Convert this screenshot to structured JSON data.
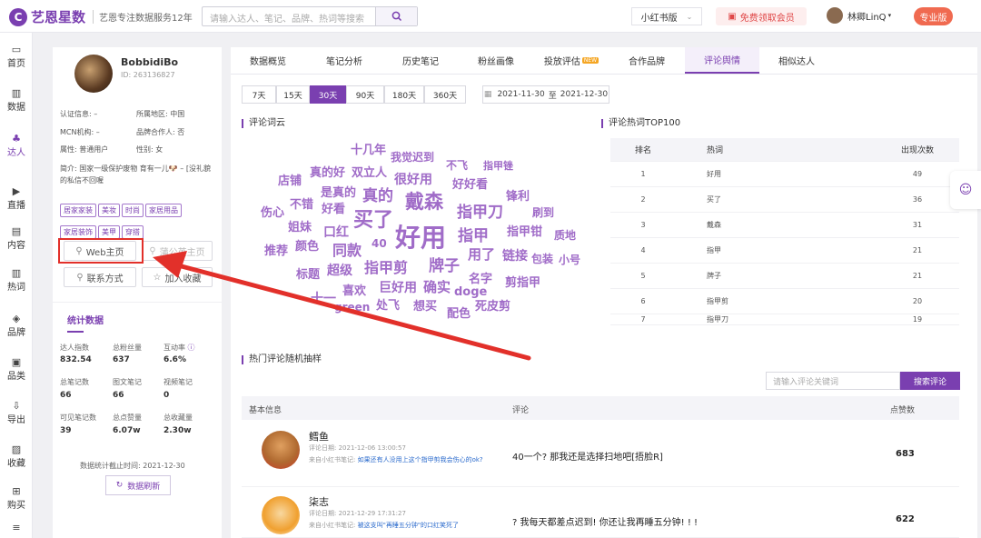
{
  "app": {
    "brand": "艺恩星数",
    "slogan": "艺恩专注数据服务12年",
    "logo_char": "C"
  },
  "search": {
    "placeholder": "请输入达人、笔记、品牌、热词等搜索"
  },
  "platform_select": "小红书版",
  "free_member": "免费领取会员",
  "user": {
    "name": "林卿LinQ",
    "plan": "专业版"
  },
  "nav": [
    {
      "label": "首页",
      "icon": "monitor-icon",
      "glyph": "▭"
    },
    {
      "label": "数据",
      "icon": "bar-chart-icon",
      "glyph": "▥"
    },
    {
      "label": "达人",
      "icon": "people-icon",
      "glyph": "♣"
    },
    {
      "label": "直播",
      "icon": "play-icon",
      "glyph": "▶"
    },
    {
      "label": "内容",
      "icon": "document-icon",
      "glyph": "▤"
    },
    {
      "label": "热词",
      "icon": "chart-icon",
      "glyph": "▥"
    },
    {
      "label": "品牌",
      "icon": "diamond-icon",
      "glyph": "◈"
    },
    {
      "label": "品类",
      "icon": "box-icon",
      "glyph": "▣"
    },
    {
      "label": "导出",
      "icon": "export-icon",
      "glyph": "⇩"
    },
    {
      "label": "收藏",
      "icon": "bookmark-icon",
      "glyph": "▨"
    },
    {
      "label": "购买",
      "icon": "cart-icon",
      "glyph": "⊞"
    },
    {
      "label": "",
      "icon": "menu-icon",
      "glyph": "≡"
    }
  ],
  "profile": {
    "name": "BobbidiBo",
    "id": "ID: 263136827",
    "cert": "认证信息: –",
    "region": "所属地区: 中国",
    "mcn": "MCN机构: –",
    "brand_partner": "品牌合作人: 否",
    "attribute": "属性: 普通用户",
    "gender": "性别: 女",
    "intro": "简介: 国家一级保护废物 育有一儿🐶 – [没礼貌的私信不回喔",
    "tags": [
      "居家家装",
      "美妆",
      "时尚",
      "家居用品",
      "家居装饰",
      "美甲",
      "穿搭"
    ],
    "web_home": "Web主页",
    "pgy_home": "蒲公英主页",
    "contact": "联系方式",
    "add_fav": "加入收藏",
    "stats_title": "统计数据",
    "stats": [
      {
        "label": "达人指数",
        "value": "832.54"
      },
      {
        "label": "总粉丝量",
        "value": "637"
      },
      {
        "label": "互动率",
        "value": "6.6%"
      },
      {
        "label": "总笔记数",
        "value": "66"
      },
      {
        "label": "图文笔记",
        "value": "66"
      },
      {
        "label": "视频笔记",
        "value": "0"
      },
      {
        "label": "可见笔记数",
        "value": "39"
      },
      {
        "label": "总点赞量",
        "value": "6.07w"
      },
      {
        "label": "总收藏量",
        "value": "2.30w"
      }
    ],
    "stats_cutoff": "数据统计截止时间: 2021-12-30",
    "refresh": "数据刷新"
  },
  "tabs": [
    "数据概览",
    "笔记分析",
    "历史笔记",
    "粉丝画像",
    "投放评估",
    "合作品牌",
    "评论舆情",
    "相似达人"
  ],
  "new_badge": "NEW",
  "date_buttons": [
    "7天",
    "15天",
    "30天",
    "90天",
    "180天",
    "360天"
  ],
  "date_range": {
    "start": "2021-11-30",
    "sep": "至",
    "end": "2021-12-30"
  },
  "wordcloud": {
    "title": "评论词云",
    "words": [
      "十几年",
      "我觉迟到",
      "不飞",
      "指甲锉",
      "店铺",
      "真的好",
      "双立人",
      "很好用",
      "好好看",
      "是真的",
      "真的",
      "戴森",
      "锋利",
      "伤心",
      "不错",
      "好看",
      "指甲刀",
      "刷到",
      "姐妹",
      "口红",
      "买了",
      "好用",
      "指甲",
      "指甲钳",
      "质地",
      "推荐",
      "颜色",
      "同款",
      "40",
      "用了",
      "链接",
      "包装",
      "小号",
      "标题",
      "超级",
      "指甲剪",
      "牌子",
      "名字",
      "喜欢",
      "巨好用",
      "确实",
      "doge",
      "剪指甲",
      "十一",
      "green",
      "处飞",
      "想买",
      "配色",
      "死皮剪"
    ]
  },
  "hotwords": {
    "title": "评论热词TOP100",
    "headers": [
      "排名",
      "热词",
      "出现次数"
    ],
    "rows": [
      [
        "1",
        "好用",
        "49"
      ],
      [
        "2",
        "买了",
        "36"
      ],
      [
        "3",
        "戴森",
        "31"
      ],
      [
        "4",
        "指甲",
        "21"
      ],
      [
        "5",
        "牌子",
        "21"
      ],
      [
        "6",
        "指甲剪",
        "20"
      ],
      [
        "7",
        "指甲刀",
        "19"
      ]
    ]
  },
  "comments": {
    "title": "热门评论随机抽样",
    "search_placeholder": "请输入评论关键词",
    "search_btn": "搜索评论",
    "headers": [
      "基本信息",
      "评论",
      "点赞数"
    ],
    "rows": [
      {
        "name": "鳕鱼",
        "date": "评论日期: 2021-12-06 13:00:57",
        "from_label": "来自小红书笔记: ",
        "from_link": "如果还有人没用上这个指甲剪我会伤心的ok?",
        "text": "40一个? 那我还是选择扫地吧[捂脸R]",
        "likes": "683"
      },
      {
        "name": "柒志",
        "date": "评论日期: 2021-12-29 17:31:27",
        "from_label": "来自小红书笔记: ",
        "from_link": "被这支叫\"再睡五分钟\"的口红笑死了",
        "text": "? 我每天都差点迟到! 你还让我再睡五分钟! ! !",
        "likes": "622"
      }
    ]
  },
  "colors": {
    "brand": "#7a3fb0",
    "accent_red": "#e2302a",
    "wordcloud": "#a06cc8"
  }
}
